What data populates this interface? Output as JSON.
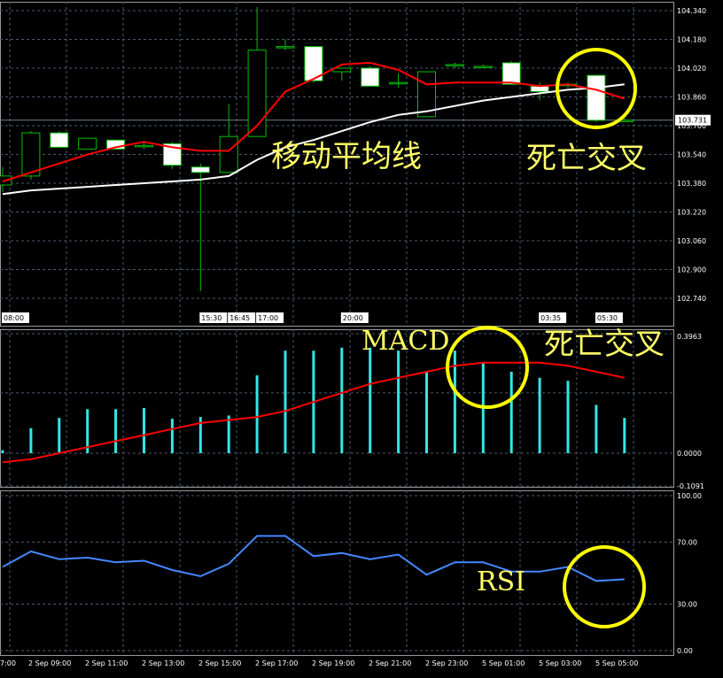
{
  "chart_data": [
    {
      "type": "candlestick",
      "title": "",
      "ylim": [
        102.66,
        104.39
      ],
      "y_ticks": [
        "104.340",
        "104.180",
        "104.020",
        "103.860",
        "103.700",
        "103.540",
        "103.380",
        "103.220",
        "103.060",
        "102.900",
        "102.740"
      ],
      "current_price_label": "103.731",
      "current_price": 103.731,
      "x_markers": [
        {
          "index": 0,
          "label": "08:00"
        },
        {
          "index": 7,
          "label": "15:30"
        },
        {
          "index": 8,
          "label": "16:45"
        },
        {
          "index": 9,
          "label": "17:00"
        },
        {
          "index": 12,
          "label": "20:00"
        },
        {
          "index": 19,
          "label": "03:35"
        },
        {
          "index": 21,
          "label": "05:30"
        }
      ],
      "candles": [
        {
          "open": 103.37,
          "high": 103.47,
          "low": 103.33,
          "close": 103.42
        },
        {
          "open": 103.42,
          "high": 103.67,
          "low": 103.4,
          "close": 103.66
        },
        {
          "open": 103.66,
          "high": 103.67,
          "low": 103.58,
          "close": 103.58
        },
        {
          "open": 103.57,
          "high": 103.63,
          "low": 103.57,
          "close": 103.63
        },
        {
          "open": 103.62,
          "high": 103.62,
          "low": 103.57,
          "close": 103.57
        },
        {
          "open": 103.59,
          "high": 103.61,
          "low": 103.57,
          "close": 103.59
        },
        {
          "open": 103.6,
          "high": 103.61,
          "low": 103.46,
          "close": 103.48
        },
        {
          "open": 103.47,
          "high": 103.49,
          "low": 102.78,
          "close": 103.44
        },
        {
          "open": 103.44,
          "high": 103.82,
          "low": 103.44,
          "close": 103.64
        },
        {
          "open": 103.64,
          "high": 104.36,
          "low": 103.64,
          "close": 104.12
        },
        {
          "open": 104.14,
          "high": 104.18,
          "low": 104.12,
          "close": 104.14
        },
        {
          "open": 104.14,
          "high": 104.14,
          "low": 103.94,
          "close": 103.95
        },
        {
          "open": 104.0,
          "high": 104.02,
          "low": 103.95,
          "close": 104.02
        },
        {
          "open": 104.02,
          "high": 104.03,
          "low": 103.92,
          "close": 103.92
        },
        {
          "open": 103.94,
          "high": 103.99,
          "low": 103.91,
          "close": 103.94
        },
        {
          "open": 103.75,
          "high": 104.0,
          "low": 103.75,
          "close": 104.0
        },
        {
          "open": 104.04,
          "high": 104.05,
          "low": 104.02,
          "close": 104.04
        },
        {
          "open": 104.03,
          "high": 104.04,
          "low": 104.02,
          "close": 104.03
        },
        {
          "open": 104.05,
          "high": 104.06,
          "low": 103.94,
          "close": 103.93
        },
        {
          "open": 103.92,
          "high": 103.94,
          "low": 103.84,
          "close": 103.89
        },
        {
          "open": 103.93,
          "high": 103.94,
          "low": 103.91,
          "close": 103.93
        },
        {
          "open": 103.98,
          "high": 103.98,
          "low": 103.72,
          "close": 103.73
        },
        {
          "open": 103.73,
          "high": 103.74,
          "low": 103.72,
          "close": 103.73
        }
      ],
      "ma_fast": [
        103.39,
        103.44,
        103.49,
        103.54,
        103.58,
        103.61,
        103.58,
        103.56,
        103.56,
        103.7,
        103.89,
        103.96,
        104.04,
        104.05,
        104.01,
        103.93,
        103.94,
        103.94,
        103.94,
        103.92,
        103.93,
        103.9,
        103.85
      ],
      "ma_slow": [
        103.32,
        103.34,
        103.35,
        103.36,
        103.37,
        103.38,
        103.39,
        103.4,
        103.42,
        103.51,
        103.58,
        103.62,
        103.67,
        103.72,
        103.76,
        103.78,
        103.81,
        103.84,
        103.86,
        103.88,
        103.9,
        103.91,
        103.93
      ],
      "ma_colors": {
        "fast": "#ff0000",
        "slow": "#ffffff"
      },
      "annotations": [
        "移动平均线",
        "死亡交叉"
      ]
    },
    {
      "type": "bar+line",
      "name": "MACD",
      "ylim": [
        -0.1091,
        0.3963
      ],
      "y_ticks": [
        "0.3963",
        "0.0000",
        "-0.1091"
      ],
      "histogram": [
        0.01,
        0.083,
        0.117,
        0.146,
        0.146,
        0.15,
        0.114,
        0.12,
        0.125,
        0.258,
        0.34,
        0.34,
        0.35,
        0.35,
        0.34,
        0.27,
        0.34,
        0.3,
        0.27,
        0.25,
        0.24,
        0.16,
        0.117
      ],
      "signal": [
        -0.03,
        -0.02,
        0.0,
        0.02,
        0.04,
        0.06,
        0.08,
        0.1,
        0.11,
        0.12,
        0.14,
        0.17,
        0.2,
        0.23,
        0.25,
        0.27,
        0.29,
        0.3,
        0.3,
        0.3,
        0.29,
        0.27,
        0.25
      ],
      "colors": {
        "histogram": "#33e6e6",
        "signal": "#ff0000"
      },
      "annotations": [
        "MACD",
        "死亡交叉"
      ]
    },
    {
      "type": "line",
      "name": "RSI",
      "ylim": [
        0,
        100
      ],
      "y_ticks": [
        "100.00",
        "70.00",
        "30.00",
        "0.00"
      ],
      "x_labels": [
        "7:00",
        "2 Sep 09:00",
        "2 Sep 11:00",
        "2 Sep 13:00",
        "2 Sep 15:00",
        "2 Sep 17:00",
        "2 Sep 19:00",
        "2 Sep 21:00",
        "2 Sep 23:00",
        "5 Sep 01:00",
        "5 Sep 03:00",
        "5 Sep 05:00"
      ],
      "values": [
        54,
        64,
        59,
        60,
        57,
        58,
        52,
        48,
        56,
        74,
        74,
        61,
        63,
        59,
        62,
        49,
        57,
        57,
        51,
        51,
        54,
        45,
        46
      ],
      "color": "#4488ff",
      "annotations": [
        "RSI"
      ]
    }
  ]
}
